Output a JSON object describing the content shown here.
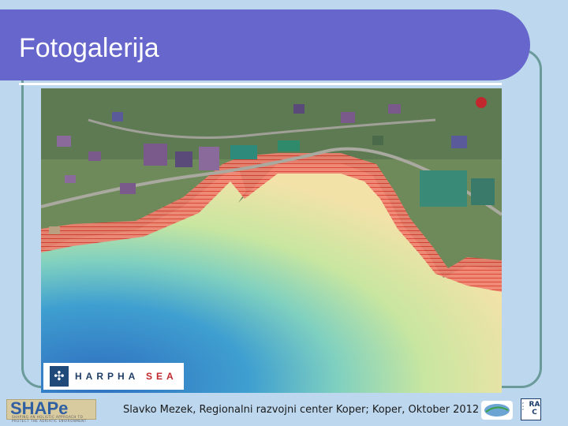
{
  "slide": {
    "title": "Fotogalerija",
    "footer": "Slavko Mezek, Regionalni razvojni center Koper; Koper, Oktober 2012"
  },
  "photo": {
    "overlay_logo": {
      "name": "HARPHA",
      "suffix": "SEA"
    }
  },
  "logos": {
    "shape": {
      "text": "SHAPe",
      "subtitle": "SHAPING AN HOLISTIC APPROACH TO PROTECT THE ADRIATIC ENVIRONMENT"
    },
    "rac": {
      "text": "RA C"
    }
  },
  "colors": {
    "title_bar": "#6666cc",
    "background": "#bdd7ee",
    "frame": "#6a9a9a",
    "setback_zone": "#e8463a",
    "sea_deep": "#3a7fc8",
    "sea_shallow": "#b8e0a0",
    "sand": "#f2e2a8"
  }
}
